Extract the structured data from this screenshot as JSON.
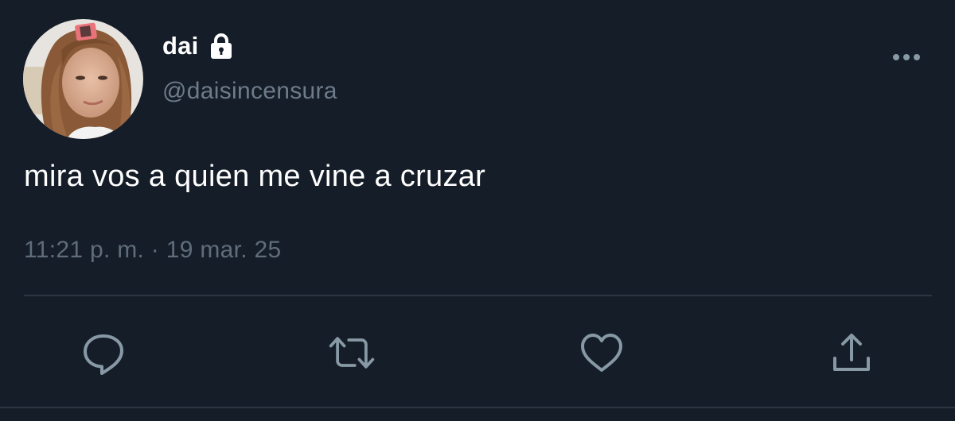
{
  "tweet": {
    "display_name": "dai",
    "handle": "@daisincensura",
    "text": "mira vos a quien me vine a cruzar",
    "time": "11:21 p. m.",
    "separator": " · ",
    "date": "19 mar. 25"
  },
  "icons": {
    "lock": "lock-icon",
    "more": "more-horizontal-icon",
    "reply": "reply-icon",
    "retweet": "retweet-icon",
    "like": "heart-icon",
    "share": "share-icon"
  },
  "colors": {
    "background": "#151d28",
    "primary_text": "#ffffff",
    "secondary_text": "#6d7b8a",
    "icon": "#8899a6",
    "divider": "#2b3643"
  }
}
